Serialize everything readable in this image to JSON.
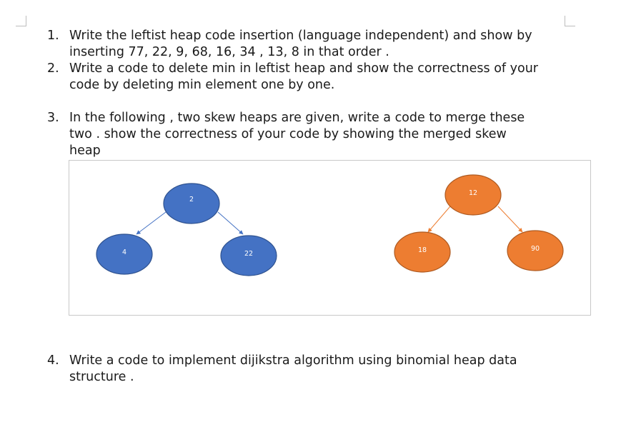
{
  "questions": [
    {
      "number": "1.",
      "lines": [
        "Write the leftist heap code insertion (language independent) and show by",
        "inserting 77, 22, 9,  68, 16, 34 , 13, 8 in that order ."
      ]
    },
    {
      "number": "2.",
      "lines": [
        "Write a code to delete min in leftist heap and show the correctness of your",
        "code by deleting min element one by one."
      ]
    },
    {
      "number": "3.",
      "lines": [
        "In the following , two skew heaps are given, write a code to merge these",
        "two . show the correctness of your code by showing the merged skew",
        "heap"
      ]
    },
    {
      "number": "4.",
      "lines": [
        "Write a code to implement dijikstra algorithm using binomial heap data",
        "structure ."
      ]
    }
  ],
  "heaps": [
    {
      "color": "#4472c4",
      "stroke": "#2f528f",
      "edge_color": "#4472c4",
      "root": "2",
      "left": "4",
      "right": "22"
    },
    {
      "color": "#ed7d31",
      "stroke": "#ae5a21",
      "edge_color": "#ed7d31",
      "root": "12",
      "left": "18",
      "right": "90"
    }
  ]
}
